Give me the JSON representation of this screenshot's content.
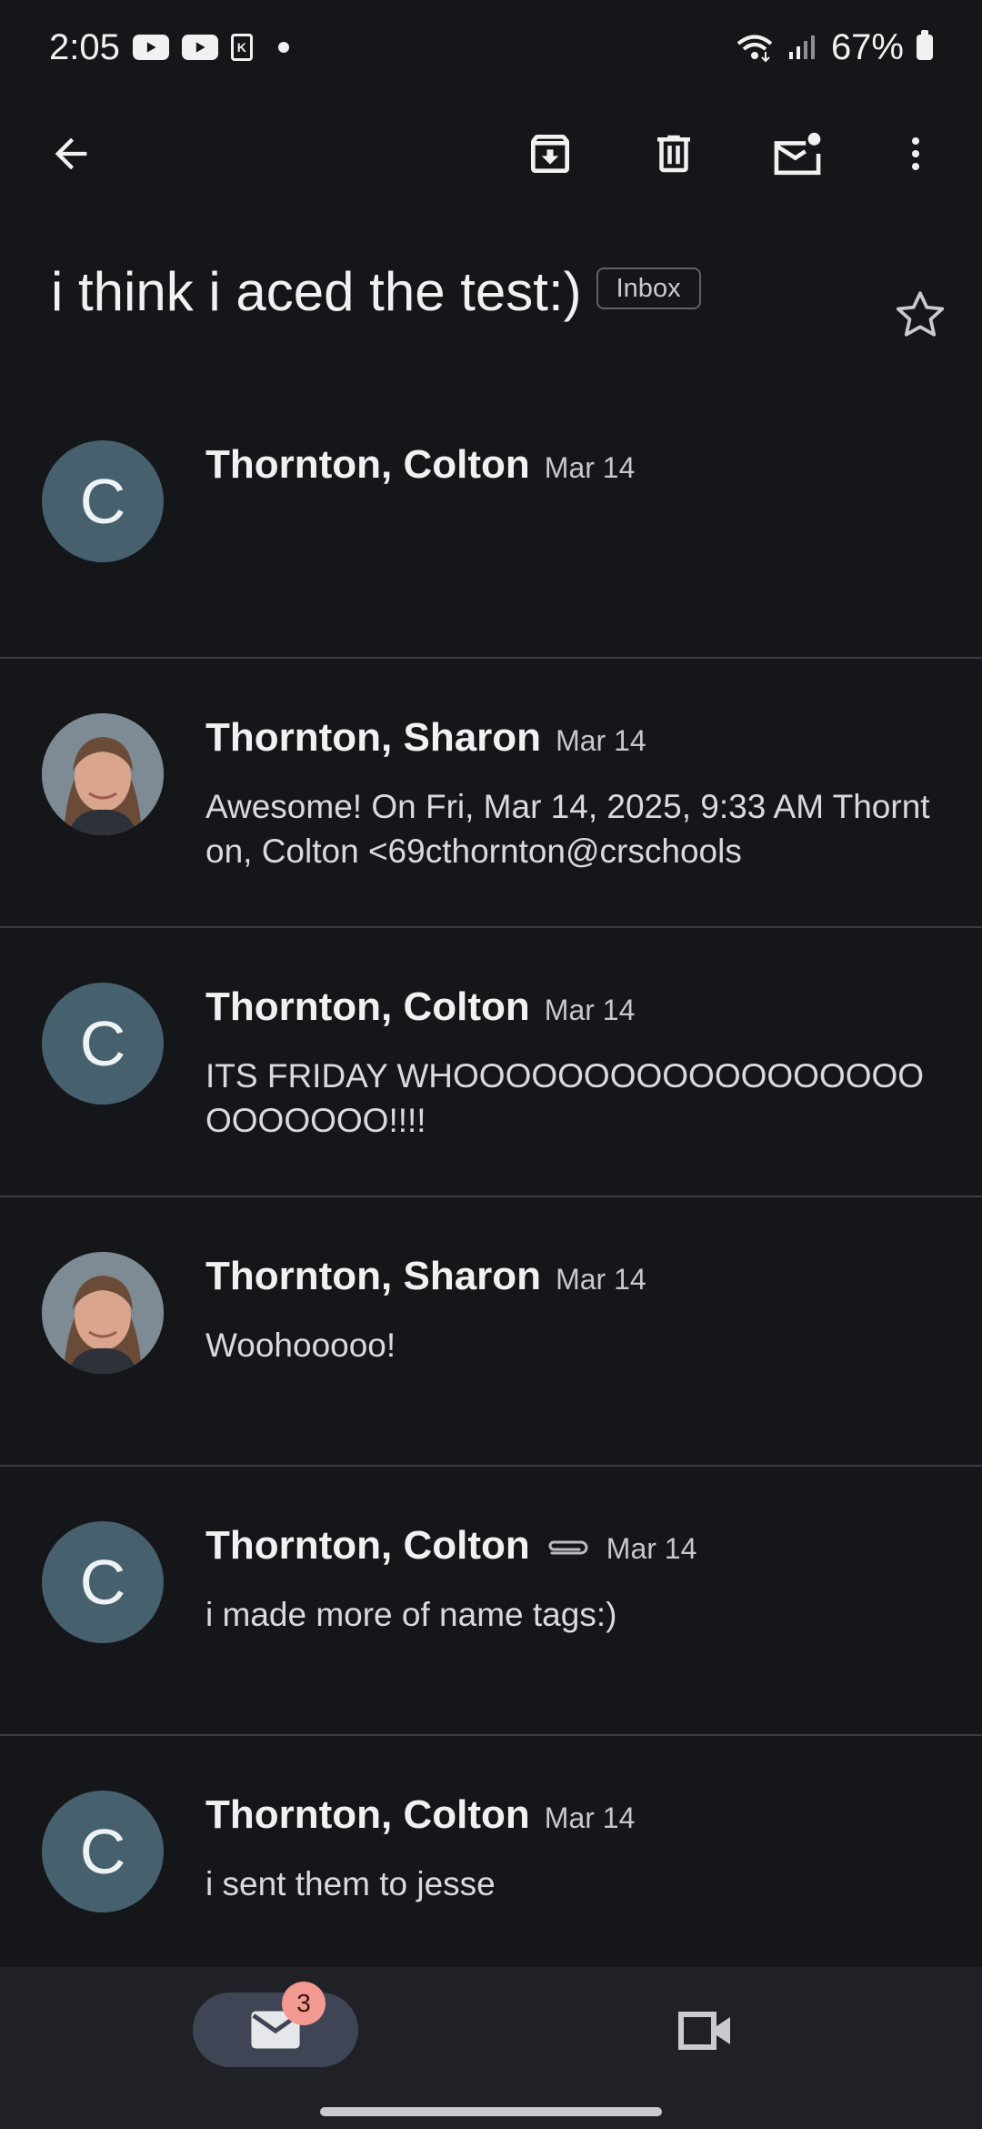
{
  "status_bar": {
    "time": "2:05",
    "battery": "67%"
  },
  "toolbar": {
    "back_icon": "arrow-back-icon",
    "archive_icon": "archive-icon",
    "delete_icon": "trash-icon",
    "mark_unread_icon": "mail-unread-icon",
    "more_icon": "more-vertical-icon"
  },
  "subject": {
    "title": "i think i aced the test:)",
    "label": "Inbox"
  },
  "messages": [
    {
      "sender": "Thornton, Colton",
      "date": "Mar 14",
      "snippet": "",
      "avatar_letter": "C"
    },
    {
      "sender": "Thornton, Sharon",
      "date": "Mar 14",
      "snippet": "Awesome! On Fri, Mar 14, 2025, 9:33 AM Thornton, Colton <69cthornton@crschools",
      "avatar_letter": ""
    },
    {
      "sender": "Thornton, Colton",
      "date": "Mar 14",
      "snippet": "ITS FRIDAY WHOOOOOOOOOOOOOOOOOOOOOOOOO!!!!",
      "avatar_letter": "C"
    },
    {
      "sender": "Thornton, Sharon",
      "date": "Mar 14",
      "snippet": "Woohooooo!",
      "avatar_letter": ""
    },
    {
      "sender": "Thornton, Colton",
      "date": "Mar 14",
      "snippet": "i made more of name tags:)",
      "avatar_letter": "C"
    },
    {
      "sender": "Thornton, Colton",
      "date": "Mar 14",
      "snippet": "i sent them to jesse",
      "avatar_letter": "C"
    }
  ],
  "bottom_nav": {
    "mail_badge": "3"
  },
  "colors": {
    "background": "#15161a",
    "avatar": "#46606e",
    "nav_active": "#3f4554",
    "badge": "#f29a92"
  }
}
